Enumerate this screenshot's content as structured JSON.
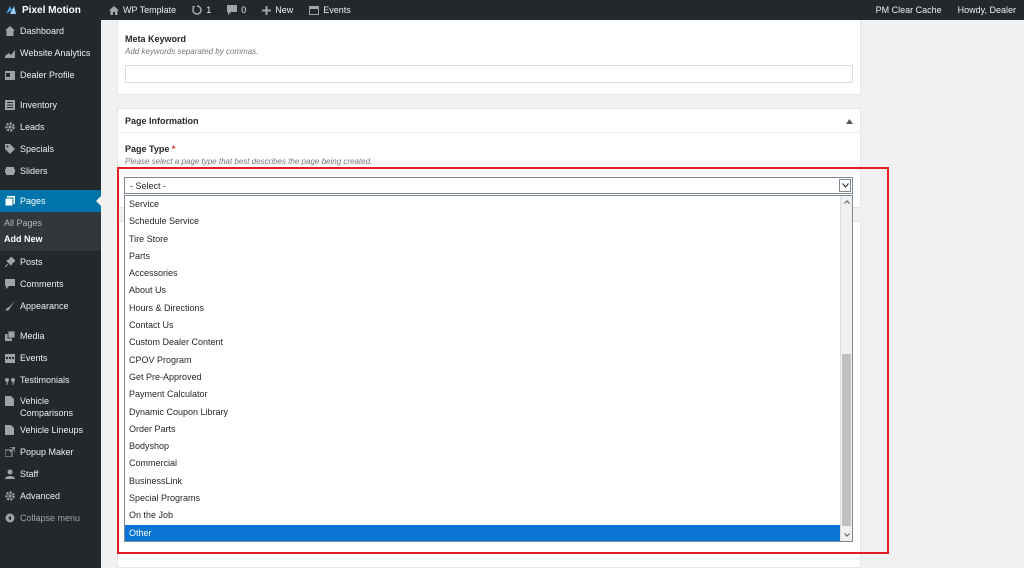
{
  "adminbar": {
    "brand": "Pixel Motion",
    "site_name": "WP Template",
    "updates_count": "1",
    "comments_count": "0",
    "new_label": "New",
    "events_label": "Events",
    "clear_cache": "PM Clear Cache",
    "howdy": "Howdy, Dealer"
  },
  "sidebar": {
    "items": [
      {
        "label": "Dashboard",
        "icon": "dashboard-icon"
      },
      {
        "label": "Website Analytics",
        "icon": "chart-icon"
      },
      {
        "label": "Dealer Profile",
        "icon": "id-card-icon"
      },
      {
        "label": "Inventory",
        "icon": "list-icon"
      },
      {
        "label": "Leads",
        "icon": "gear-icon"
      },
      {
        "label": "Specials",
        "icon": "tag-icon"
      },
      {
        "label": "Sliders",
        "icon": "slides-icon"
      },
      {
        "label": "Pages",
        "icon": "pages-icon"
      },
      {
        "label": "Posts",
        "icon": "pin-icon"
      },
      {
        "label": "Comments",
        "icon": "comment-icon"
      },
      {
        "label": "Appearance",
        "icon": "brush-icon"
      },
      {
        "label": "Media",
        "icon": "media-icon"
      },
      {
        "label": "Events",
        "icon": "calendar-icon"
      },
      {
        "label": "Testimonials",
        "icon": "quote-icon"
      },
      {
        "label": "Vehicle",
        "label2": "Comparisons",
        "icon": "doc-icon"
      },
      {
        "label": "Vehicle Lineups",
        "icon": "doc-icon"
      },
      {
        "label": "Popup Maker",
        "icon": "popup-icon"
      },
      {
        "label": "Staff",
        "icon": "staff-icon"
      },
      {
        "label": "Advanced",
        "icon": "gear-icon"
      },
      {
        "label": "Collapse menu",
        "icon": "collapse-icon"
      }
    ],
    "submenu": [
      "All Pages",
      "Add New"
    ]
  },
  "meta_keyword": {
    "label": "Meta Keyword",
    "description": "Add keywords separated by commas.",
    "value": ""
  },
  "page_information": {
    "title": "Page Information",
    "page_type_label": "Page Type",
    "required_mark": "*",
    "page_type_description": "Please select a page type that best describes the page being created.",
    "selected_value": "- Select -"
  },
  "dropdown": {
    "options": [
      "Service",
      "Schedule Service",
      "Tire Store",
      "Parts",
      "Accessories",
      "About Us",
      "Hours & Directions",
      "Contact Us",
      "Custom Dealer Content",
      "CPOV Program",
      "Get Pre-Approved",
      "Payment Calculator",
      "Dynamic Coupon Library",
      "Order Parts",
      "Bodyshop",
      "Commercial",
      "BusinessLink",
      "Special Programs",
      "On the Job",
      "Other"
    ],
    "highlighted": "Other"
  },
  "colors": {
    "admin_dark": "#23282d",
    "wp_blue": "#0073aa",
    "option_highlight": "#0a74d4",
    "annotation_red": "#e31b23"
  }
}
